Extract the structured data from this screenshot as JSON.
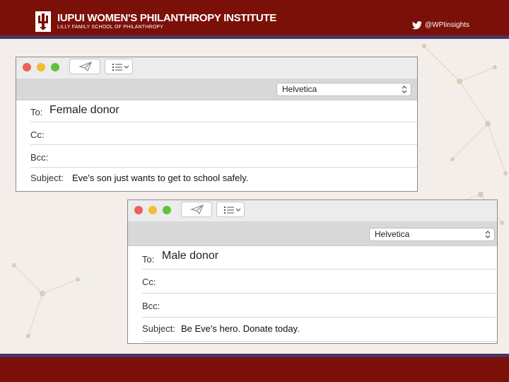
{
  "header": {
    "title": "IUPUI WOMEN'S PHILANTHROPY INSTITUTE",
    "subtitle": "LILLY FAMILY SCHOOL OF PHILANTHROPY",
    "twitter_handle": "@WPIinsights"
  },
  "colors": {
    "brand_red": "#7b1008",
    "accent_purple": "#4a3566"
  },
  "windows": [
    {
      "font": "Helvetica",
      "to_label": "To:",
      "to_value": "Female donor",
      "cc_label": "Cc:",
      "bcc_label": "Bcc:",
      "subject_label": "Subject:",
      "subject_value": "Eve's son just wants to get to school safely."
    },
    {
      "font": "Helvetica",
      "to_label": "To:",
      "to_value": "Male donor",
      "cc_label": "Cc:",
      "bcc_label": "Bcc:",
      "subject_label": "Subject:",
      "subject_value": "Be Eve's hero. Donate today."
    }
  ],
  "icons": {
    "send": "paper-plane-icon",
    "format": "list-icon",
    "twitter": "twitter-bird-icon",
    "logo": "iu-trident-icon"
  }
}
